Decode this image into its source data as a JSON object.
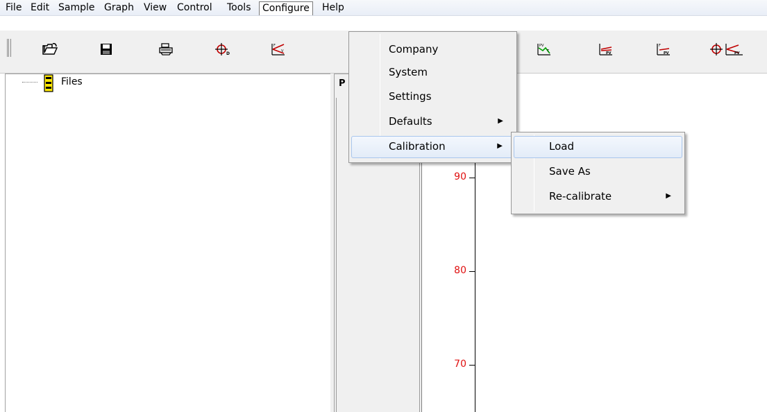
{
  "menubar": {
    "items": [
      "File",
      "Edit",
      "Sample",
      "Graph",
      "View",
      "Control",
      "Tools",
      "Configure",
      "Help"
    ],
    "active": "Configure"
  },
  "toolbar": {
    "buttons": [
      "open-folder-icon",
      "save-disk-icon",
      "print-icon",
      "crosshair-d-icon",
      "f-v-graph-icon",
      "pv-graph-icon",
      "pv-chart-icon",
      "f-pv-chart-icon",
      "crosshair-f-pv-icon"
    ]
  },
  "tree": {
    "root_label": "Files"
  },
  "panel": {
    "tab_label": "P"
  },
  "chart_axis": {
    "tick_labels": [
      "90",
      "80",
      "70"
    ],
    "tick_color": "#e01010"
  },
  "configure_menu": {
    "items": [
      {
        "label": "Company",
        "submenu": false
      },
      {
        "label": "System",
        "submenu": false
      },
      {
        "label": "Settings",
        "submenu": false
      },
      {
        "label": "Defaults",
        "submenu": true
      },
      {
        "label": "Calibration",
        "submenu": true
      }
    ],
    "highlighted": "Calibration"
  },
  "calibration_menu": {
    "items": [
      {
        "label": "Load",
        "submenu": false
      },
      {
        "label": "Save As",
        "submenu": false
      },
      {
        "label": "Re-calibrate",
        "submenu": true
      }
    ],
    "highlighted": "Load"
  }
}
